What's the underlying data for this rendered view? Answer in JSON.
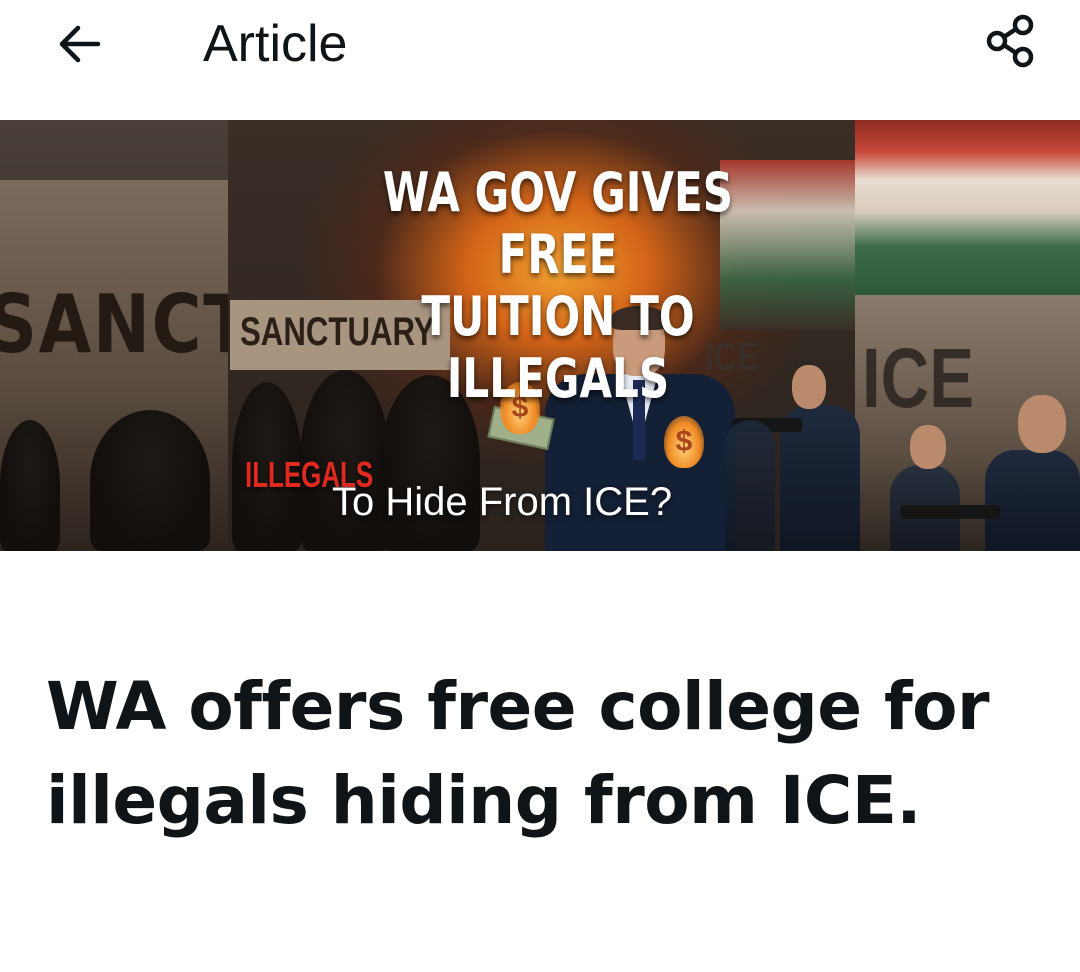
{
  "header": {
    "title": "Article",
    "back_icon": "arrow-left-icon",
    "share_icon": "share-icon"
  },
  "banner": {
    "headline": "WA GOV GIVES FREE\nTUITION TO ILLEGALS",
    "sign_left": "SANCTU",
    "sign_sanctuary": "SANCTUARY",
    "sign_ice_small": "ICE",
    "sign_ice_big": "ICE",
    "illegals": "ILLEGALS",
    "subline": "To Hide From ICE?",
    "dollar_symbol": "$"
  },
  "article": {
    "title": "WA offers free college for illegals hiding from ICE."
  },
  "colors": {
    "text": "#0f1419",
    "background": "#ffffff",
    "accent_red": "#e02a20"
  }
}
